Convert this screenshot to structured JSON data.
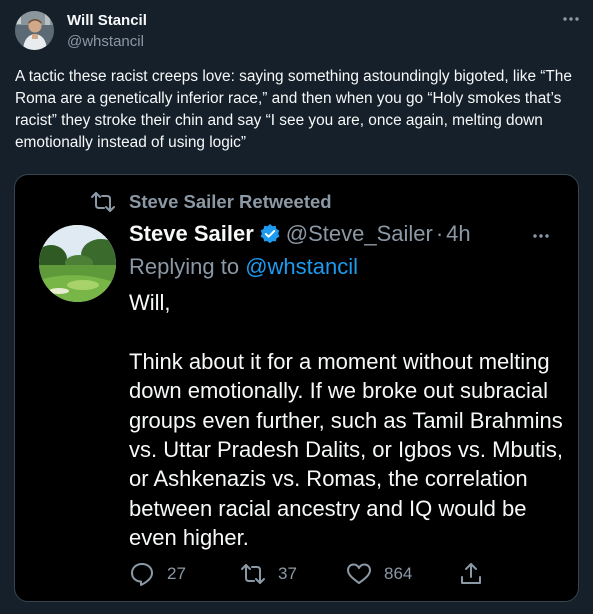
{
  "tweet": {
    "author_name": "Will Stancil",
    "author_handle": "@whstancil",
    "text": "A tactic these racist creeps love: saying something astoundingly bigoted, like “The Roma are a genetically inferior race,” and then when you go “Holy smokes that’s racist” they stroke their chin and say “I see you are, once again, melting down emotionally instead of using logic”",
    "more_icon": "more-horizontal-icon"
  },
  "quoted": {
    "retweeted_by": "Steve Sailer Retweeted",
    "author_name": "Steve Sailer",
    "author_handle": "@Steve_Sailer",
    "separator": "·",
    "time": "4h",
    "verified_icon": "verified-badge-icon",
    "reply_prefix": "Replying to",
    "reply_to": "@whstancil",
    "body": "Will,\n\nThink about it for a moment without melting down emotionally. If we broke out subracial groups even further, such as Tamil Brahmins vs. Uttar Pradesh Dalits, or Igbos vs. Mbutis, or Ashkenazis vs. Romas, the correlation between racial ancestry and IQ would be even higher.",
    "actions": {
      "replies": "27",
      "retweets": "37",
      "likes": "864"
    }
  },
  "colors": {
    "page_bg": "#15202b",
    "card_bg": "#000000",
    "text": "#f7f9f9",
    "secondary": "#8b98a5",
    "link": "#1d9bf0"
  }
}
